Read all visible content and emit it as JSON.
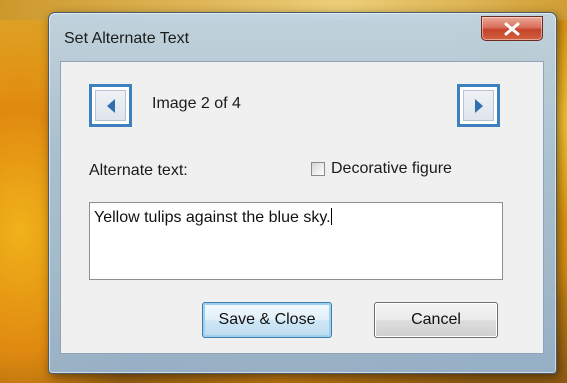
{
  "dialog": {
    "title": "Set Alternate Text",
    "close_icon": "close-x-icon",
    "prev_icon": "triangle-left-icon",
    "next_icon": "triangle-right-icon",
    "image_counter": "Image 2 of 4",
    "alt_text_label": "Alternate text:",
    "alt_text_value": "Yellow tulips against the blue sky.",
    "decorative_label": "Decorative figure",
    "decorative_checked": false,
    "save_label": "Save & Close",
    "cancel_label": "Cancel",
    "colors": {
      "accent": "#3d7fbf",
      "close_button": "#c4442c"
    }
  }
}
